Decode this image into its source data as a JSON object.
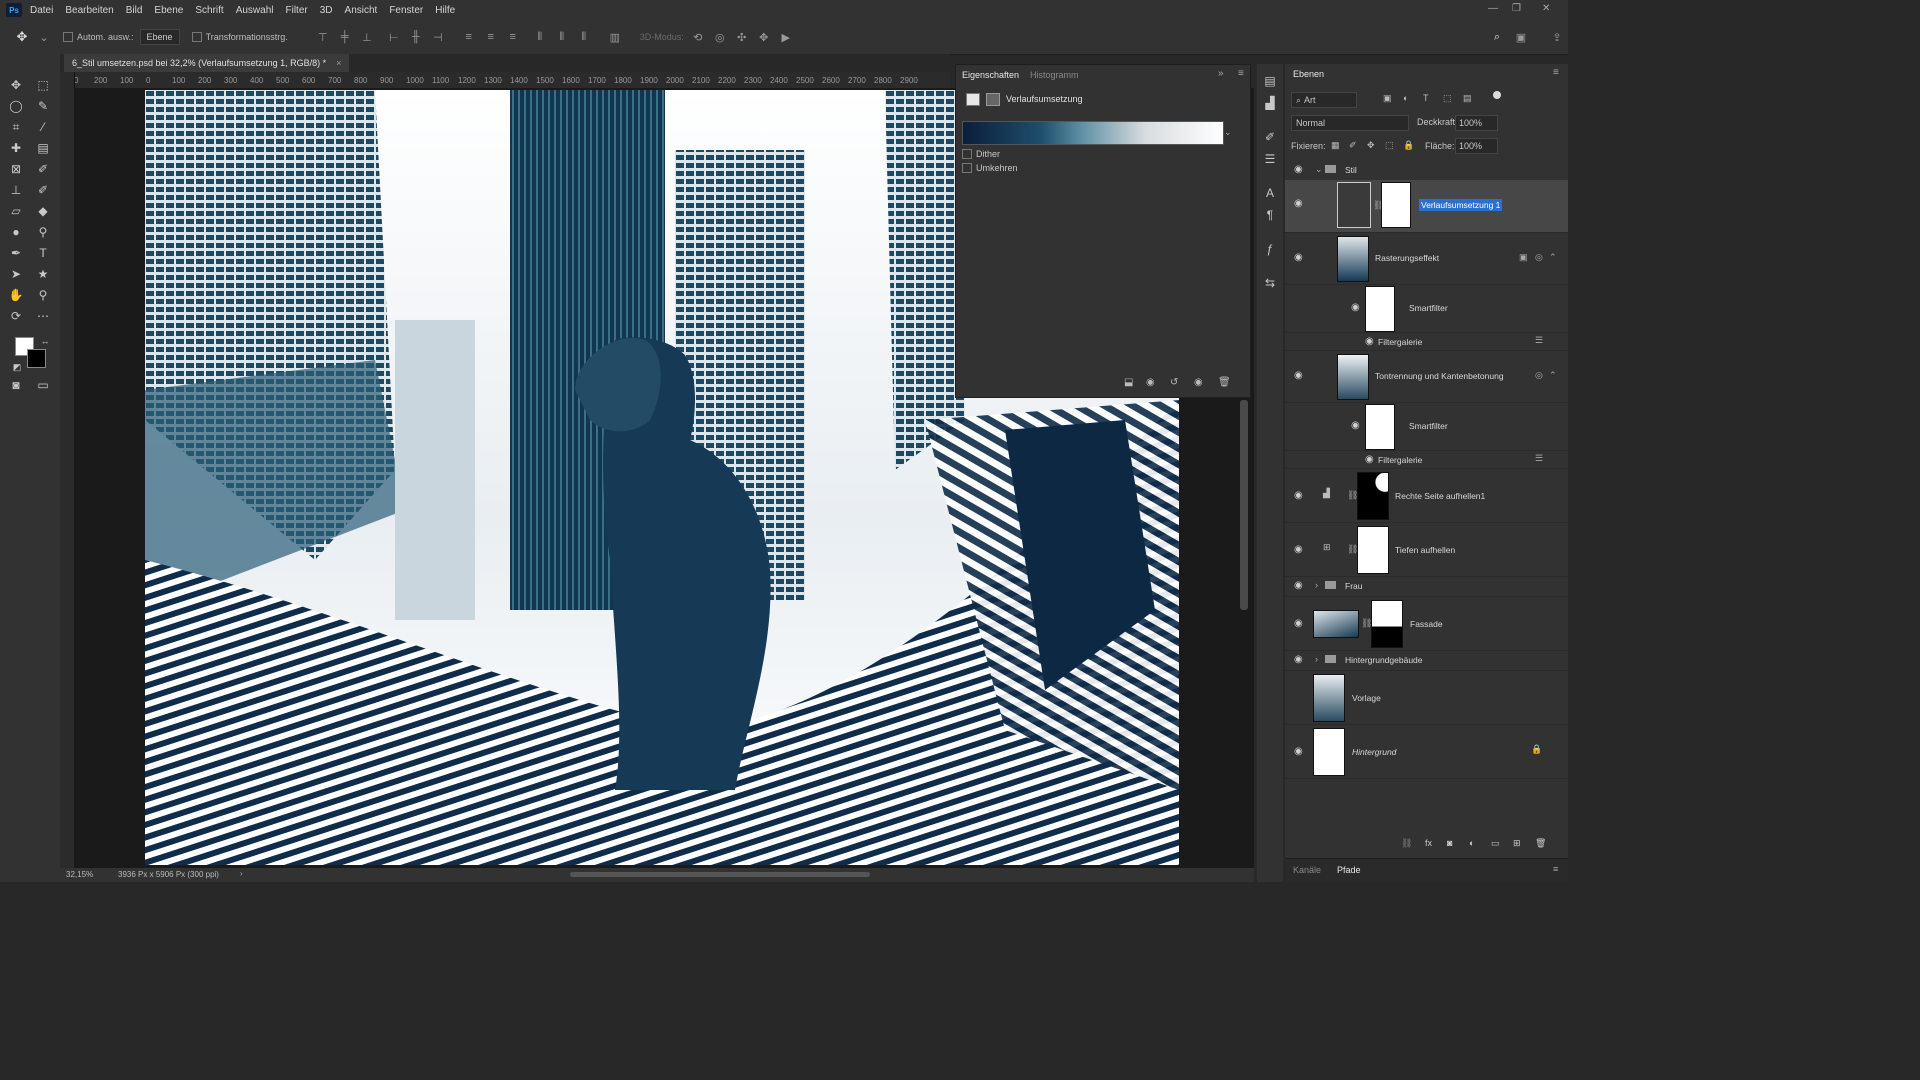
{
  "menubar": {
    "logo": "Ps",
    "items": [
      "Datei",
      "Bearbeiten",
      "Bild",
      "Ebene",
      "Schrift",
      "Auswahl",
      "Filter",
      "3D",
      "Ansicht",
      "Fenster",
      "Hilfe"
    ]
  },
  "options": {
    "auto_select_label": "Autom. ausw.:",
    "auto_select_value": "Ebene",
    "transform_label": "Transformationsstrg.",
    "mode_3d": "3D-Modus:"
  },
  "document": {
    "tab_title": "6_Stil umsetzen.psd bei 32,2% (Verlaufsumsetzung 1, RGB/8) *",
    "ruler_ticks": [
      "0",
      "200",
      "100",
      "0",
      "100",
      "200",
      "300",
      "400",
      "500",
      "600",
      "700",
      "800",
      "900",
      "1000",
      "1100",
      "1200",
      "1300",
      "1400",
      "1500",
      "1600",
      "1700",
      "1800",
      "1900",
      "2000",
      "2100",
      "2200",
      "2300",
      "2400",
      "2500",
      "2600",
      "2700",
      "2800",
      "2900"
    ],
    "zoom": "32,15%",
    "doc_size": "3936 Px x 5906 Px (300 ppi)"
  },
  "properties": {
    "tabs": [
      "Eigenschaften",
      "Histogramm"
    ],
    "title": "Verlaufsumsetzung",
    "dither_label": "Dither",
    "reverse_label": "Umkehren"
  },
  "layers_panel": {
    "title": "Ebenen",
    "filter_kind": "Art",
    "blend_mode": "Normal",
    "opacity_label": "Deckkraft:",
    "opacity_value": "100%",
    "lock_label": "Fixieren:",
    "fill_label": "Fläche:",
    "fill_value": "100%",
    "layers": {
      "stil": "Stil",
      "verlauf": "Verlaufsumsetzung 1",
      "raster": "Rasterungseffekt",
      "smartfilter1": "Smartfilter",
      "filtergalerie1": "Filtergalerie",
      "tontrennung": "Tontrennung und Kantenbetonung",
      "smartfilter2": "Smartfilter",
      "filtergalerie2": "Filtergalerie",
      "rechte": "Rechte Seite aufhellen1",
      "tiefen": "Tiefen aufhellen",
      "frau": "Frau",
      "fassade": "Fassade",
      "hintergrundgebaeude": "Hintergrundgebäude",
      "vorlage": "Vorlage",
      "hintergrund": "Hintergrund"
    },
    "bottom_tabs": [
      "Kanäle",
      "Pfade"
    ]
  },
  "colors": {
    "accent_selection": "#2b6fd0",
    "gradient_dark": "#0a1f3a",
    "gradient_mid": "#2f6f88"
  }
}
